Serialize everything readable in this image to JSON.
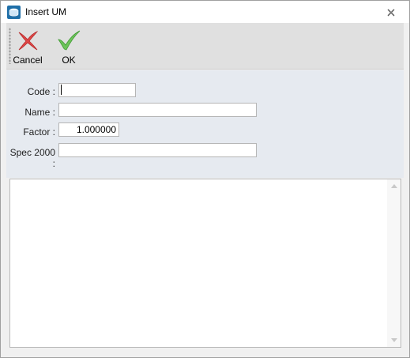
{
  "window": {
    "title": "Insert UM",
    "app_icon": "database-icon",
    "close_icon": "close-icon"
  },
  "toolbar": {
    "cancel_label": "Cancel",
    "cancel_icon": "red-x-icon",
    "ok_label": "OK",
    "ok_icon": "green-check-icon"
  },
  "form": {
    "code_label": "Code :",
    "code_value": "",
    "name_label": "Name :",
    "name_value": "",
    "factor_label": "Factor :",
    "factor_value": "1.000000",
    "spec_label": "Spec 2000 :",
    "spec_value": ""
  },
  "memo": {
    "text": ""
  },
  "colors": {
    "toolbar_bg": "#e0e0e0",
    "form_bg": "#e6eaf0",
    "cancel_red": "#e04848",
    "ok_green": "#6cc35a"
  }
}
